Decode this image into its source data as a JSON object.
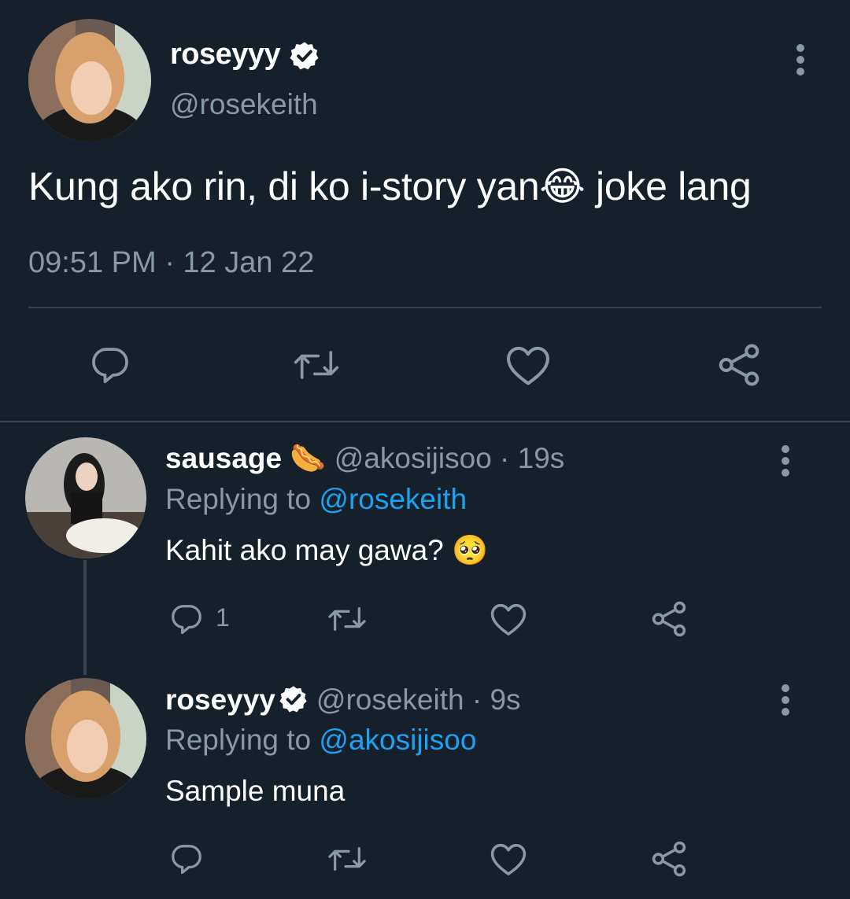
{
  "main_tweet": {
    "display_name": "roseyyy",
    "handle": "@rosekeith",
    "text": "Kung ako rin, di ko i-story yan😂 joke lang",
    "timestamp": "09:51 PM · 12 Jan 22"
  },
  "replies": [
    {
      "display_name": "sausage 🌭",
      "handle": "@akosijisoo",
      "age": "19s",
      "replying_label": "Replying to",
      "replying_to": "@rosekeith",
      "text": "Kahit ako may gawa? 🥺",
      "reply_count": "1"
    },
    {
      "display_name": "roseyyy",
      "handle": "@rosekeith",
      "age": "9s",
      "replying_label": "Replying to",
      "replying_to": "@akosijisoo",
      "text": "Sample muna"
    }
  ],
  "icons": {
    "reply": "reply-icon",
    "retweet": "retweet-icon",
    "like": "heart-icon",
    "share": "share-icon",
    "more": "more-vertical-icon",
    "verified": "verified-badge-icon"
  },
  "colors": {
    "background": "#15202b",
    "secondary_text": "#8899a6",
    "link": "#1da1f2",
    "divider": "#38444d"
  }
}
